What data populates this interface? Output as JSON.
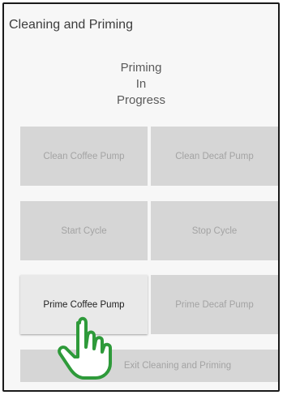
{
  "header": {
    "title": "Cleaning and Priming"
  },
  "status": {
    "lines": [
      "Priming",
      "In",
      "Progress"
    ]
  },
  "buttons": {
    "clean_coffee": "Clean Coffee Pump",
    "clean_decaf": "Clean Decaf Pump",
    "start_cycle": "Start Cycle",
    "stop_cycle": "Stop Cycle",
    "prime_coffee": "Prime Coffee Pump",
    "prime_decaf": "Prime Decaf Pump",
    "exit": "Exit Cleaning and Priming"
  },
  "colors": {
    "hand_outline": "#2e9a3a",
    "button_disabled": "#d6d6d6",
    "button_active": "#e9e9e9"
  },
  "icons": {
    "pointer": "hand-pointer-icon"
  }
}
